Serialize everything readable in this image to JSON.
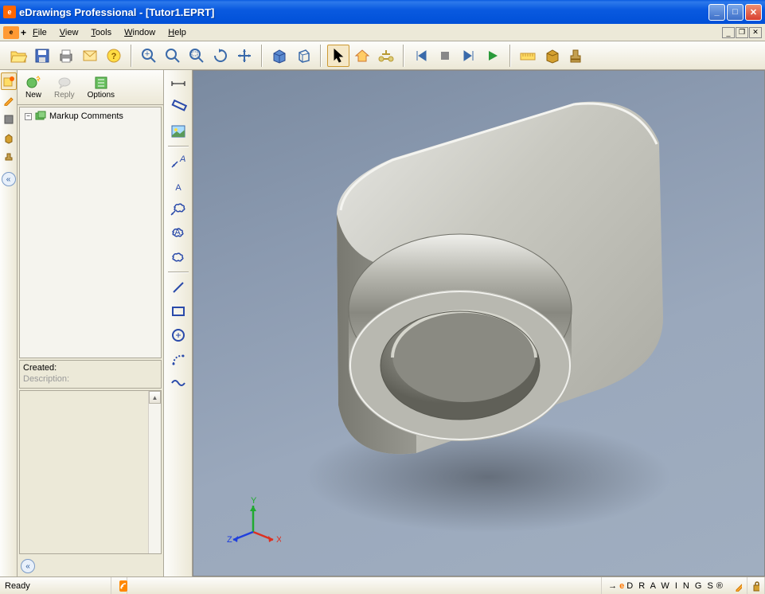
{
  "window": {
    "title": "eDrawings Professional - [Tutor1.EPRT]"
  },
  "menu": {
    "items": [
      "File",
      "View",
      "Tools",
      "Window",
      "Help"
    ]
  },
  "panel": {
    "new": "New",
    "reply": "Reply",
    "options": "Options",
    "tree_root": "Markup Comments",
    "created": "Created:",
    "description": "Description:"
  },
  "status": {
    "ready": "Ready",
    "brand": "D R A W I N G S"
  },
  "triad": {
    "x": "X",
    "y": "Y",
    "z": "Z"
  }
}
